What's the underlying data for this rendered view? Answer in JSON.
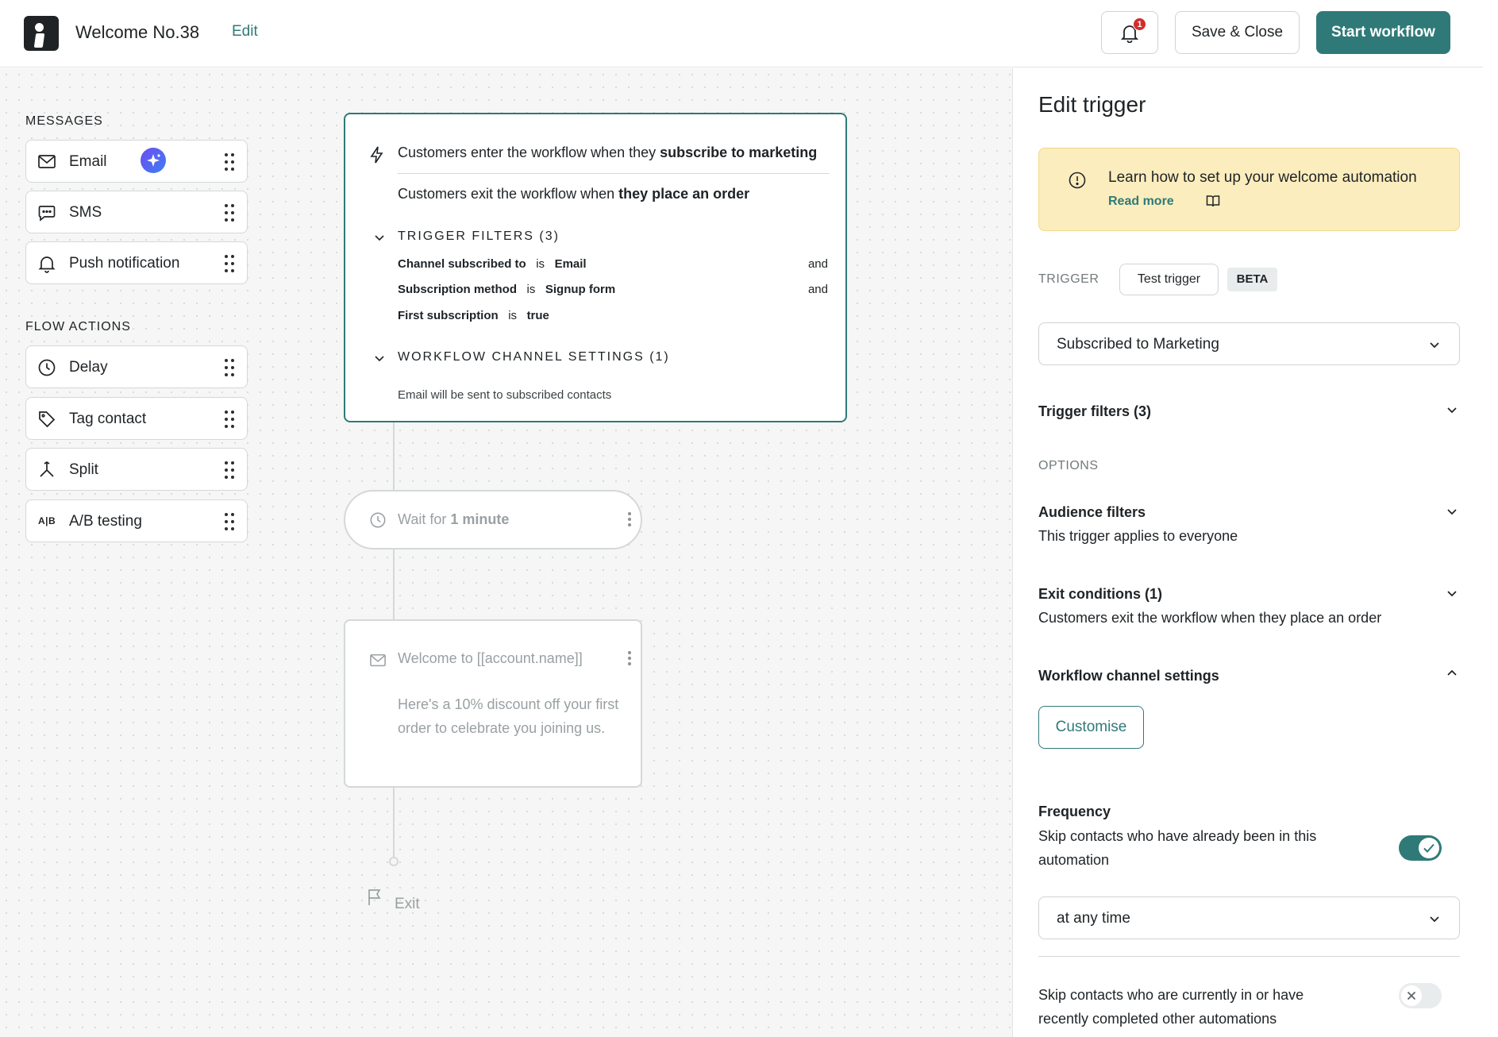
{
  "header": {
    "workflow_name": "Welcome No.38",
    "edit_link": "Edit",
    "notification_count": "1",
    "save_close_label": "Save & Close",
    "start_label": "Start workflow"
  },
  "palette": {
    "messages_heading": "MESSAGES",
    "messages": [
      {
        "label": "Email",
        "icon": "mail-icon"
      },
      {
        "label": "SMS",
        "icon": "chat-bubble-icon"
      },
      {
        "label": "Push notification",
        "icon": "bell-icon"
      }
    ],
    "flow_heading": "FLOW ACTIONS",
    "flow_actions": [
      {
        "label": "Delay",
        "icon": "clock-icon"
      },
      {
        "label": "Tag contact",
        "icon": "tag-icon"
      },
      {
        "label": "Split",
        "icon": "split-icon"
      },
      {
        "label": "A/B testing",
        "icon": "ab-testing-icon",
        "icon_text": "A|B"
      }
    ]
  },
  "trigger_card": {
    "enter_prefix": "Customers enter the workflow when they ",
    "enter_bold": "subscribe to marketing",
    "exit_prefix": "Customers exit the workflow when ",
    "exit_bold": "they place an order",
    "filters_heading": "TRIGGER FILTERS (3)",
    "filters": [
      {
        "field": "Channel subscribed to",
        "op": "is",
        "value": "Email",
        "join": "and"
      },
      {
        "field": "Subscription method",
        "op": "is",
        "value": "Signup form",
        "join": "and"
      },
      {
        "field": "First subscription",
        "op": "is",
        "value": "true",
        "join": ""
      }
    ],
    "channel_heading": "WORKFLOW CHANNEL SETTINGS (1)",
    "channel_text": "Email will be sent to subscribed contacts"
  },
  "wait_node": {
    "prefix": "Wait for ",
    "bold": "1 minute"
  },
  "email_node": {
    "subject": "Welcome to [[account.name]]",
    "body": "Here's a 10% discount off your first order to celebrate you joining us."
  },
  "exit_node": {
    "label": "Exit"
  },
  "panel": {
    "title": "Edit trigger",
    "info_text": "Learn how to set up your welcome automation",
    "info_link": "Read more",
    "trigger_label": "TRIGGER",
    "test_trigger": "Test trigger",
    "beta": "BETA",
    "trigger_value": "Subscribed to Marketing",
    "trigger_filters": "Trigger filters (3)",
    "options_label": "OPTIONS",
    "audience_title": "Audience filters",
    "audience_sub": "This trigger applies to everyone",
    "exit_title": "Exit conditions (1)",
    "exit_sub": "Customers exit the workflow when they place an order",
    "channel_title": "Workflow channel settings",
    "customise": "Customise",
    "frequency_title": "Frequency",
    "frequency_text": "Skip contacts who have already been in this automation",
    "frequency_toggle_on": true,
    "frequency_value": "at any time",
    "skip_text": "Skip contacts who are currently in or have recently completed other automations",
    "skip_toggle_on": false
  },
  "colors": {
    "accent": "#2f7a78",
    "info_bg": "#fbedbd",
    "badge": "#d52b2b",
    "canvas_bg": "#f5f6f5"
  }
}
